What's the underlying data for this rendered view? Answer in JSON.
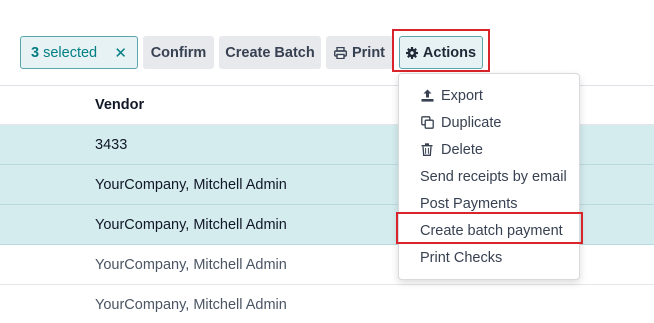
{
  "toolbar": {
    "selected_count": "3",
    "selected_text": "selected",
    "clear_icon": "close-icon",
    "confirm_label": "Confirm",
    "create_batch_label": "Create Batch",
    "print_label": "Print",
    "print_icon": "print-icon",
    "actions_label": "Actions",
    "actions_icon": "gear-icon"
  },
  "table": {
    "vendor_header": "Vendor",
    "rows": [
      {
        "vendor": "3433",
        "selected": true
      },
      {
        "vendor": "YourCompany, Mitchell Admin",
        "selected": true
      },
      {
        "vendor": "YourCompany, Mitchell Admin",
        "selected": true
      },
      {
        "vendor": "YourCompany, Mitchell Admin",
        "selected": false
      },
      {
        "vendor": "YourCompany, Mitchell Admin",
        "selected": false
      }
    ]
  },
  "actions_menu": {
    "items": [
      {
        "label": "Export",
        "icon": "upload-icon"
      },
      {
        "label": "Duplicate",
        "icon": "copy-icon"
      },
      {
        "label": "Delete",
        "icon": "trash-icon"
      },
      {
        "label": "Send receipts by email",
        "icon": ""
      },
      {
        "label": "Post Payments",
        "icon": ""
      },
      {
        "label": "Create batch payment",
        "icon": ""
      },
      {
        "label": "Print Checks",
        "icon": ""
      }
    ]
  },
  "colors": {
    "accent": "#017e84",
    "selected_row": "#d4ecee",
    "highlight_box": "#d9242b",
    "button_gray": "#e7e9ed"
  }
}
